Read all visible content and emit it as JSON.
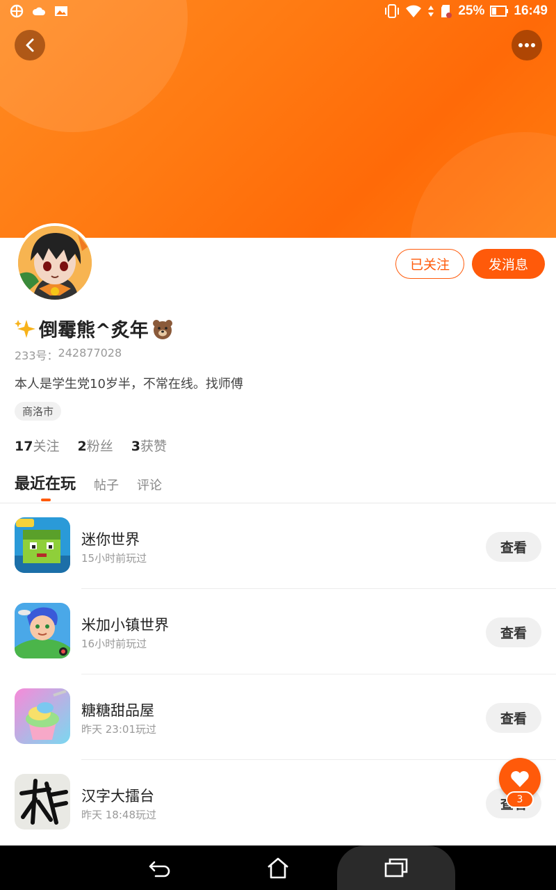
{
  "status_bar": {
    "battery": "25%",
    "time": "16:49"
  },
  "header": {
    "back_icon": "chevron-left-icon",
    "more_icon": "more-dots-icon"
  },
  "profile": {
    "name": "倒霉熊^炙年",
    "id_label": "233号：",
    "id_value": "242877028",
    "bio": "本人是学生党10岁半，不常在线。找师傅",
    "city": "商洛市",
    "follow_label": "已关注",
    "message_label": "发消息",
    "stats": [
      {
        "num": "17",
        "label": "关注"
      },
      {
        "num": "2",
        "label": "粉丝"
      },
      {
        "num": "3",
        "label": "获赞"
      }
    ]
  },
  "tabs": [
    {
      "label": "最近在玩",
      "active": true
    },
    {
      "label": "帖子",
      "active": false
    },
    {
      "label": "评论",
      "active": false
    }
  ],
  "games": [
    {
      "name": "迷你世界",
      "time": "15小时前玩过",
      "button": "查看"
    },
    {
      "name": "米加小镇世界",
      "time": "16小时前玩过",
      "button": "查看"
    },
    {
      "name": "糖糖甜品屋",
      "time": "昨天 23:01玩过",
      "button": "查看"
    },
    {
      "name": "汉字大擂台",
      "time": "昨天 18:48玩过",
      "button": "查看"
    }
  ],
  "fab": {
    "icon": "heart-icon",
    "count": "3"
  },
  "colors": {
    "accent": "#ff5a0a",
    "banner": "#ff7a12"
  }
}
